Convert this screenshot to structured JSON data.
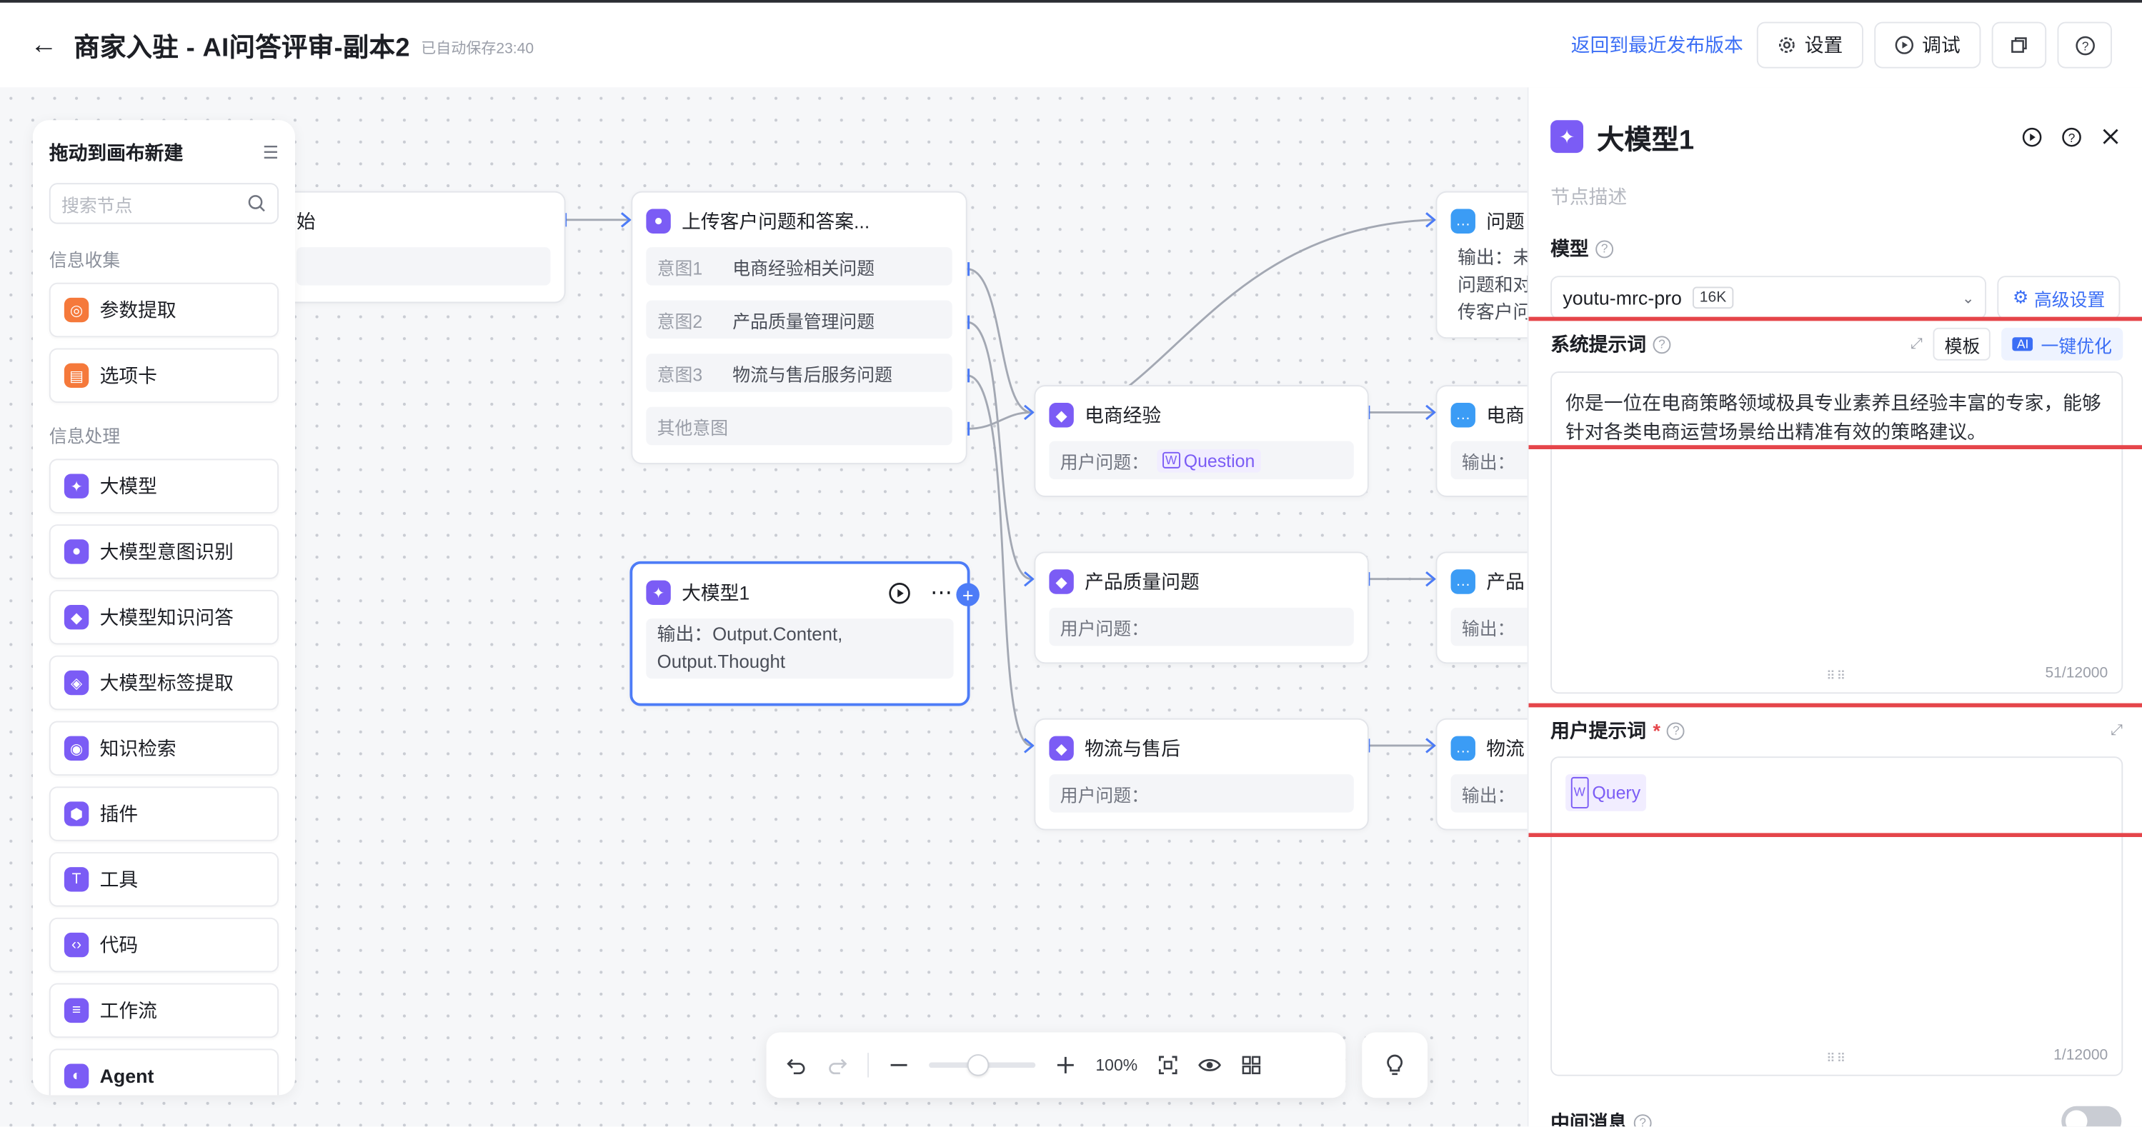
{
  "header": {
    "title": "商家入驻 - AI问答评审-副本2",
    "autosave": "已自动保存23:40",
    "revert_link": "返回到最近发布版本",
    "settings_label": "设置",
    "debug_label": "调试"
  },
  "library": {
    "title": "拖动到画布新建",
    "search_placeholder": "搜索节点",
    "sections": [
      {
        "title": "信息收集",
        "items": [
          {
            "label": "参数提取",
            "icon": "param-extract-icon",
            "color": "#f5793b"
          },
          {
            "label": "选项卡",
            "icon": "option-card-icon",
            "color": "#f5793b"
          }
        ]
      },
      {
        "title": "信息处理",
        "items": [
          {
            "label": "大模型",
            "icon": "llm-icon",
            "color": "#7b5cf5"
          },
          {
            "label": "大模型意图识别",
            "icon": "intent-icon",
            "color": "#7b5cf5"
          },
          {
            "label": "大模型知识问答",
            "icon": "knowledge-qa-icon",
            "color": "#7b5cf5"
          },
          {
            "label": "大模型标签提取",
            "icon": "tag-extract-icon",
            "color": "#7b5cf5"
          },
          {
            "label": "知识检索",
            "icon": "knowledge-search-icon",
            "color": "#7b5cf5"
          },
          {
            "label": "插件",
            "icon": "plugin-icon",
            "color": "#7b5cf5"
          },
          {
            "label": "工具",
            "icon": "tool-icon",
            "color": "#7b5cf5"
          },
          {
            "label": "代码",
            "icon": "code-icon",
            "color": "#7b5cf5"
          },
          {
            "label": "工作流",
            "icon": "workflow-icon",
            "color": "#7b5cf5"
          },
          {
            "label": "Agent",
            "icon": "agent-icon",
            "color": "#7b5cf5"
          }
        ]
      }
    ]
  },
  "nodes": {
    "start": {
      "title": "始"
    },
    "intent": {
      "title": "上传客户问题和答案...",
      "rows": [
        {
          "key": "意图1",
          "value": "电商经验相关问题"
        },
        {
          "key": "意图2",
          "value": "产品质量管理问题"
        },
        {
          "key": "意图3",
          "value": "物流与售后服务问题"
        },
        {
          "key": "",
          "value": "其他意图"
        }
      ]
    },
    "llm1": {
      "title": "大模型1",
      "output": "输出：Output.Content, Output.Thought"
    },
    "ecom": {
      "title": "电商经验",
      "field": "用户问题：",
      "tag": "Question"
    },
    "quality": {
      "title": "产品质量问题",
      "field": "用户问题："
    },
    "logistics": {
      "title": "物流与售后",
      "field": "用户问题："
    },
    "r1": {
      "title": "问题",
      "lines": [
        "输出：未",
        "问题和对",
        "传客户问"
      ]
    },
    "r2": {
      "title": "电商",
      "field": "输出："
    },
    "r3": {
      "title": "产品",
      "field": "输出："
    },
    "r4": {
      "title": "物流",
      "field": "输出："
    }
  },
  "toolbar": {
    "zoom": "100%"
  },
  "panel": {
    "title": "大模型1",
    "desc_placeholder": "节点描述",
    "model_label": "模型",
    "model_value": "youtu-mrc-pro",
    "context": "16K",
    "advanced": "高级设置",
    "system_prompt_label": "系统提示词",
    "template_btn": "模板",
    "optimize_btn": "一键优化",
    "system_prompt_text": "你是一位在电商策略领域极具专业素养且经验丰富的专家，能够针对各类电商运营场景给出精准有效的策略建议。",
    "system_count": "51/12000",
    "user_prompt_label": "用户提示词",
    "user_prompt_tag": "Query",
    "user_count": "1/12000",
    "middle_msg_label": "中间消息"
  },
  "colors": {
    "accent": "#3b6ef5",
    "purple": "#7b5cf5",
    "highlight": "#e5454a",
    "blue_node": "#3b9cf5"
  }
}
